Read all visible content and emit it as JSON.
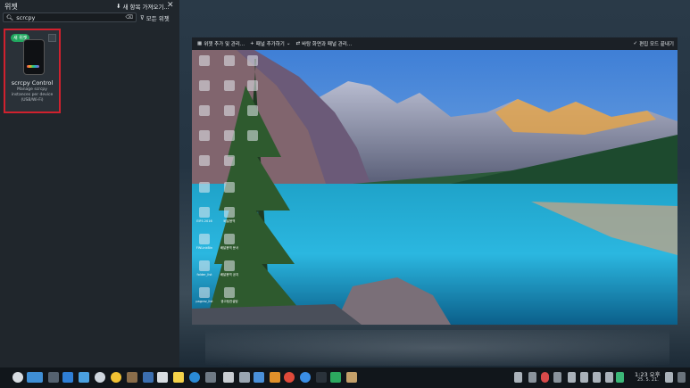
{
  "panel": {
    "title": "위젯",
    "get_new_label": "새 항목 가져오기...",
    "search_value": "scrcpy",
    "filter_label": "모든 위젯"
  },
  "widget": {
    "badge": "새 위젯",
    "name": "scrcpy Control",
    "description": "Manage scrcpy instances per device (USB/Wi-Fi)"
  },
  "toolbar": {
    "add_widgets": "위젯 추가 및 관리...",
    "add_panel": "패널 추가하기",
    "configure_displays": "바탕 화면과 패널 관리...",
    "exit_edit": "편집 모드 끝내기"
  },
  "desktop_icons": [
    {
      "label": ""
    },
    {
      "label": ""
    },
    {
      "label": ""
    },
    {
      "label": ""
    },
    {
      "label": ""
    },
    {
      "label": ""
    },
    {
      "label": ""
    },
    {
      "label": ""
    },
    {
      "label": ""
    },
    {
      "label": ""
    },
    {
      "label": ""
    },
    {
      "label": ""
    },
    {
      "label": "EIFS 2016"
    },
    {
      "label": "배달용역"
    },
    {
      "label": "FWLinkBin"
    },
    {
      "label": "배달용역 문서"
    },
    {
      "label": "folder_list"
    },
    {
      "label": "배달용역 공지"
    },
    {
      "label": "pagrav_list"
    },
    {
      "label": "광고팀컨설팅"
    }
  ],
  "clock": {
    "time": "1:23 오후",
    "date": "25. 5. 21."
  },
  "colors": {
    "highlight_border": "#d0212e",
    "badge": "#21a85f"
  }
}
